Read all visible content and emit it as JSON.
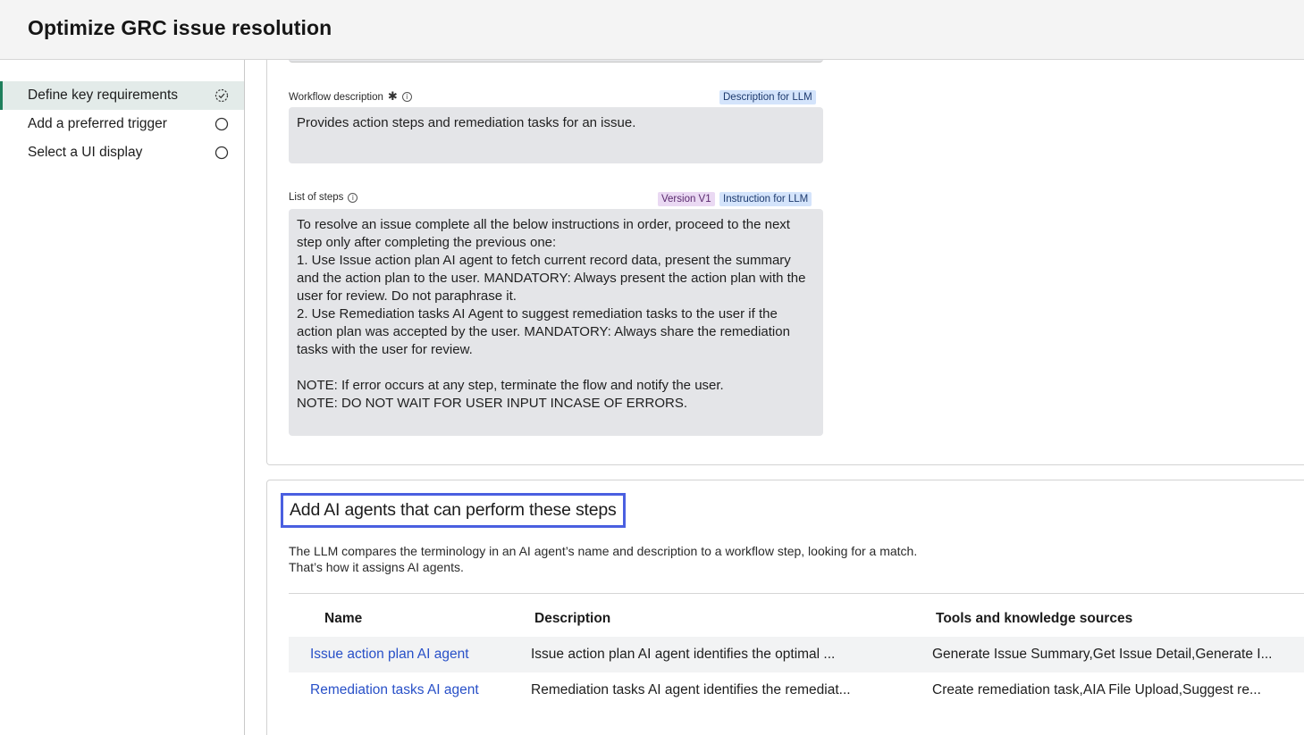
{
  "header": {
    "title": "Optimize GRC issue resolution"
  },
  "sidebar": {
    "steps": [
      {
        "label": "Define key requirements",
        "status": "in-progress"
      },
      {
        "label": "Add a preferred trigger",
        "status": "not-started"
      },
      {
        "label": "Select a UI display",
        "status": "not-started"
      }
    ]
  },
  "workflow_description": {
    "label": "Workflow description",
    "badge": "Description for LLM",
    "value": "Provides action steps and remediation tasks for an issue."
  },
  "list_of_steps": {
    "label": "List of steps",
    "version_badge": "Version V1",
    "badge": "Instruction for LLM",
    "value": "To resolve an issue complete all the below instructions in order, proceed to the next step only after completing the previous one:\n1. Use Issue action plan AI agent to fetch current record data, present the summary and the action plan to the user. MANDATORY: Always present the action plan with the user for review. Do not paraphrase it.\n2. Use Remediation tasks AI Agent to suggest remediation tasks to the user if the action plan was accepted by the user. MANDATORY: Always share the remediation tasks with the user for review.\n\nNOTE: If error occurs at any step, terminate the flow and notify the user.\nNOTE: DO NOT WAIT FOR USER INPUT INCASE OF ERRORS."
  },
  "agents_section": {
    "title": "Add AI agents that can perform these steps",
    "description_line1": "The LLM compares the terminology in an AI agent’s name and description to a workflow step, looking for a match.",
    "description_line2": "That’s how it assigns AI agents.",
    "columns": [
      "Name",
      "Description",
      "Tools and knowledge sources"
    ],
    "rows": [
      {
        "name": "Issue action plan AI agent",
        "description": "Issue action plan AI agent identifies the optimal ...",
        "tools": "Generate Issue Summary,Get Issue Detail,Generate I..."
      },
      {
        "name": "Remediation tasks AI agent",
        "description": "Remediation tasks AI agent identifies the remediat...",
        "tools": "Create remediation task,AIA File Upload,Suggest re..."
      }
    ]
  },
  "colors": {
    "accent_green": "#1f7f5c",
    "highlight_border": "#4a5fe0",
    "link": "#2850c8",
    "llm_badge": "#d4e4fb",
    "version_badge": "#ead9f3"
  }
}
